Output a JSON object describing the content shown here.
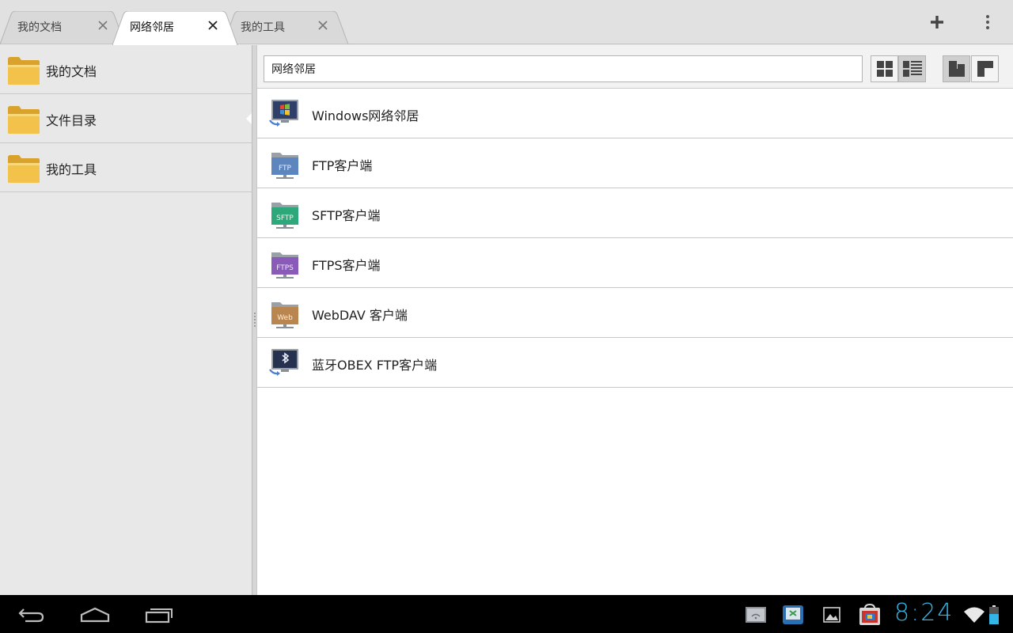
{
  "tabs": [
    {
      "label": "我的文档",
      "active": false
    },
    {
      "label": "网络邻居",
      "active": true
    },
    {
      "label": "我的工具",
      "active": false
    }
  ],
  "toolbar": {
    "add_icon": "plus-icon",
    "menu_icon": "overflow-menu-icon"
  },
  "sidebar": {
    "items": [
      {
        "label": "我的文档",
        "icon": "folder-icon"
      },
      {
        "label": "文件目录",
        "icon": "folder-icon"
      },
      {
        "label": "我的工具",
        "icon": "folder-icon"
      }
    ]
  },
  "pathbar": {
    "value": "网络邻居"
  },
  "view_buttons": [
    "grid-view-icon",
    "list-view-icon",
    "layout-split-icon",
    "layout-alt-icon"
  ],
  "list": [
    {
      "label": "Windows网络邻居",
      "icon": "windows-network-icon"
    },
    {
      "label": "FTP客户端",
      "icon": "ftp-folder-icon",
      "badge": "FTP",
      "color": "#5d86bf"
    },
    {
      "label": "SFTP客户端",
      "icon": "sftp-folder-icon",
      "badge": "SFTP",
      "color": "#2ea87a"
    },
    {
      "label": "FTPS客户端",
      "icon": "ftps-folder-icon",
      "badge": "FTPS",
      "color": "#8a5ab8"
    },
    {
      "label": "WebDAV 客户端",
      "icon": "webdav-folder-icon",
      "badge": "Web",
      "color": "#b98650"
    },
    {
      "label": "蓝牙OBEX FTP客户端",
      "icon": "bluetooth-ftp-icon"
    }
  ],
  "systembar": {
    "time": "8:24",
    "accent": "#33b5e5",
    "nav": [
      "back-icon",
      "home-icon",
      "recent-apps-icon"
    ],
    "notifications": [
      "network-notification-icon",
      "app-notification-icon",
      "image-notification-icon",
      "store-notification-icon"
    ]
  }
}
